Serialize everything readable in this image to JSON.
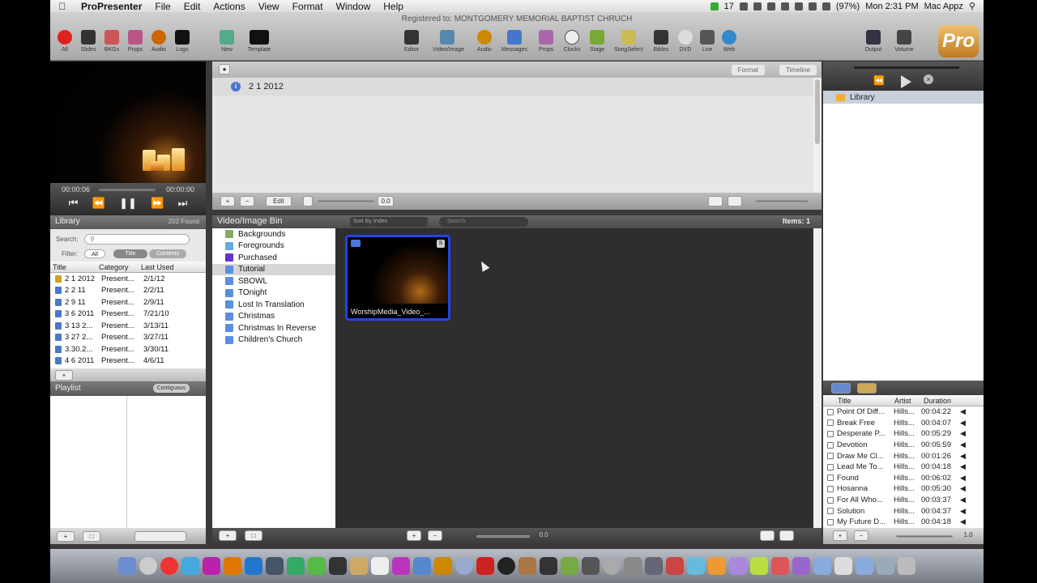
{
  "menubar": {
    "app": "ProPresenter",
    "items": [
      "File",
      "Edit",
      "Actions",
      "View",
      "Format",
      "Window",
      "Help"
    ],
    "battery": "(97%)",
    "clock": "Mon 2:31 PM",
    "user": "Mac Appz",
    "badge_count": "17"
  },
  "toolbar": {
    "registered": "Registered to: MONTGOMERY MEMORIAL BAPTIST CHRUCH",
    "left": [
      "All",
      "Slides",
      "BKGs",
      "Props",
      "Audio",
      "Logo"
    ],
    "new_label": "New",
    "template_label": "Template",
    "center": [
      "Editor",
      "Video/Image",
      "Audio",
      "Messages",
      "Props",
      "Clocks",
      "Stage",
      "SongSelect",
      "Bibles",
      "DVD",
      "Live",
      "Web"
    ],
    "output_label": "Output",
    "volume_label": "Volume",
    "logo": "Pro"
  },
  "transport": {
    "elapsed": "00:00:06",
    "remaining": "00:00:00"
  },
  "library": {
    "title": "Library",
    "count": "202 Found",
    "search_label": "Search:",
    "filter_label": "Filter:",
    "filter_value": "All",
    "seg_title": "Title",
    "seg_contents": "Contents",
    "columns": [
      "Title",
      "Category",
      "Last Used"
    ],
    "rows": [
      {
        "title": "2 1 2012",
        "category": "Present...",
        "last": "2/1/12"
      },
      {
        "title": "2 2 11",
        "category": "Present...",
        "last": "2/2/11"
      },
      {
        "title": "2 9 11",
        "category": "Present...",
        "last": "2/9/11"
      },
      {
        "title": "3 6 2011",
        "category": "Present...",
        "last": "7/21/10"
      },
      {
        "title": "3 13 2...",
        "category": "Present...",
        "last": "3/13/11"
      },
      {
        "title": "3 27 2...",
        "category": "Present...",
        "last": "3/27/11"
      },
      {
        "title": "3.30.2...",
        "category": "Present...",
        "last": "3/30/11"
      },
      {
        "title": "4 6 2011",
        "category": "Present...",
        "last": "4/6/11"
      }
    ]
  },
  "playlist": {
    "title": "Playlist",
    "mode": "Contiguous"
  },
  "document": {
    "tabs": [
      "Format",
      "Timeline"
    ],
    "item": "2 1 2012",
    "edit_label": "Edit",
    "zoom_value": "0.0"
  },
  "bin": {
    "title": "Video/Image Bin",
    "sort": "Sort By Index",
    "search_placeholder": "Search",
    "items": "Items: 1",
    "folders": [
      "Backgrounds",
      "Foregrounds",
      "Purchased",
      "Tutorial",
      "SBOWL",
      "TOnight",
      "Lost In Translation",
      "Christmas",
      "Christmas In Reverse",
      "Children's Church"
    ],
    "thumbnail_caption": "WorshipMedia_Video_...",
    "foot_value": "0.0"
  },
  "right": {
    "library_item": "Library",
    "columns": [
      "Title",
      "Artist",
      "Duration"
    ],
    "songs": [
      {
        "title": "Point Of Diff...",
        "artist": "Hills...",
        "duration": "00:04:22"
      },
      {
        "title": "Break Free",
        "artist": "Hills...",
        "duration": "00:04:07"
      },
      {
        "title": "Desperate P...",
        "artist": "Hills...",
        "duration": "00:05:29"
      },
      {
        "title": "Devotion",
        "artist": "Hills...",
        "duration": "00:05:59"
      },
      {
        "title": "Draw Me Cl...",
        "artist": "Hills...",
        "duration": "00:01:26"
      },
      {
        "title": "Lead Me To...",
        "artist": "Hills...",
        "duration": "00:04:18"
      },
      {
        "title": "Found",
        "artist": "Hills...",
        "duration": "00:06:02"
      },
      {
        "title": "Hosanna",
        "artist": "Hills...",
        "duration": "00:05:30"
      },
      {
        "title": "For All Who...",
        "artist": "Hills...",
        "duration": "00:03:37"
      },
      {
        "title": "Solution",
        "artist": "Hills...",
        "duration": "00:04:37"
      },
      {
        "title": "My Future D...",
        "artist": "Hills...",
        "duration": "00:04:18"
      }
    ],
    "foot_value": "1.0"
  },
  "colors": {
    "accent": "#2244ee",
    "brand": "#c07a20",
    "folder_blue": "#5b8de0"
  }
}
